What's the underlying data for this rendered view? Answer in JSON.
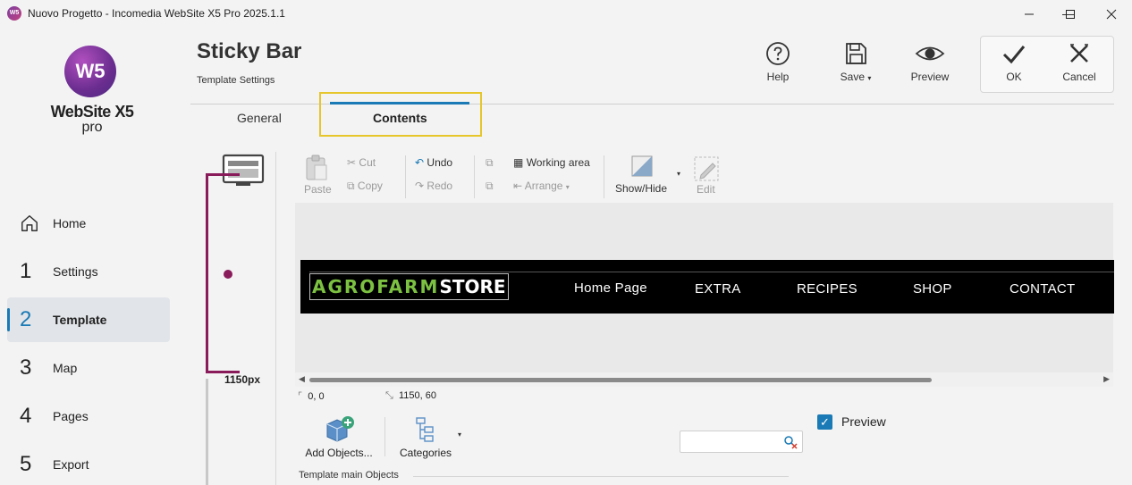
{
  "window": {
    "app_icon": "W5",
    "title": "Nuovo Progetto - Incomedia WebSite X5 Pro 2025.1.1",
    "minimize": "—",
    "maximize": "☐",
    "close": "✕"
  },
  "logo": {
    "mark": "W5",
    "name": "WebSite X5",
    "edition": "pro"
  },
  "nav": {
    "home": "Home",
    "items": [
      {
        "num": "1",
        "label": "Settings"
      },
      {
        "num": "2",
        "label": "Template"
      },
      {
        "num": "3",
        "label": "Map"
      },
      {
        "num": "4",
        "label": "Pages"
      },
      {
        "num": "5",
        "label": "Export"
      }
    ],
    "active": "Template"
  },
  "header": {
    "title": "Sticky Bar",
    "subtitle": "Template Settings",
    "help": "Help",
    "save": "Save",
    "preview": "Preview",
    "ok": "OK",
    "cancel": "Cancel"
  },
  "tabs": {
    "general": "General",
    "contents": "Contents",
    "active": "Contents"
  },
  "toolbar": {
    "paste": "Paste",
    "cut": "Cut",
    "copy": "Copy",
    "undo": "Undo",
    "redo": "Redo",
    "working_area": "Working area",
    "arrange": "Arrange",
    "show_hide": "Show/Hide",
    "edit": "Edit"
  },
  "layout_panel": {
    "width_label": "1150px"
  },
  "canvas": {
    "brand_colored": "AGROFARM",
    "brand_white": "STORE",
    "brand_color": "#7cc142",
    "menu": [
      "Home Page",
      "EXTRA",
      "RECIPES",
      "SHOP",
      "CONTACT"
    ]
  },
  "status": {
    "position": "0, 0",
    "size": "1150, 60"
  },
  "objects": {
    "add": "Add Objects...",
    "categories": "Categories",
    "preview": "Preview",
    "preview_checked": true,
    "search_value": "",
    "section": "Template main Objects"
  },
  "colors": {
    "accent": "#1a7ab5",
    "bracket": "#8a1b5b",
    "tab_highlight": "#e6c62a"
  }
}
